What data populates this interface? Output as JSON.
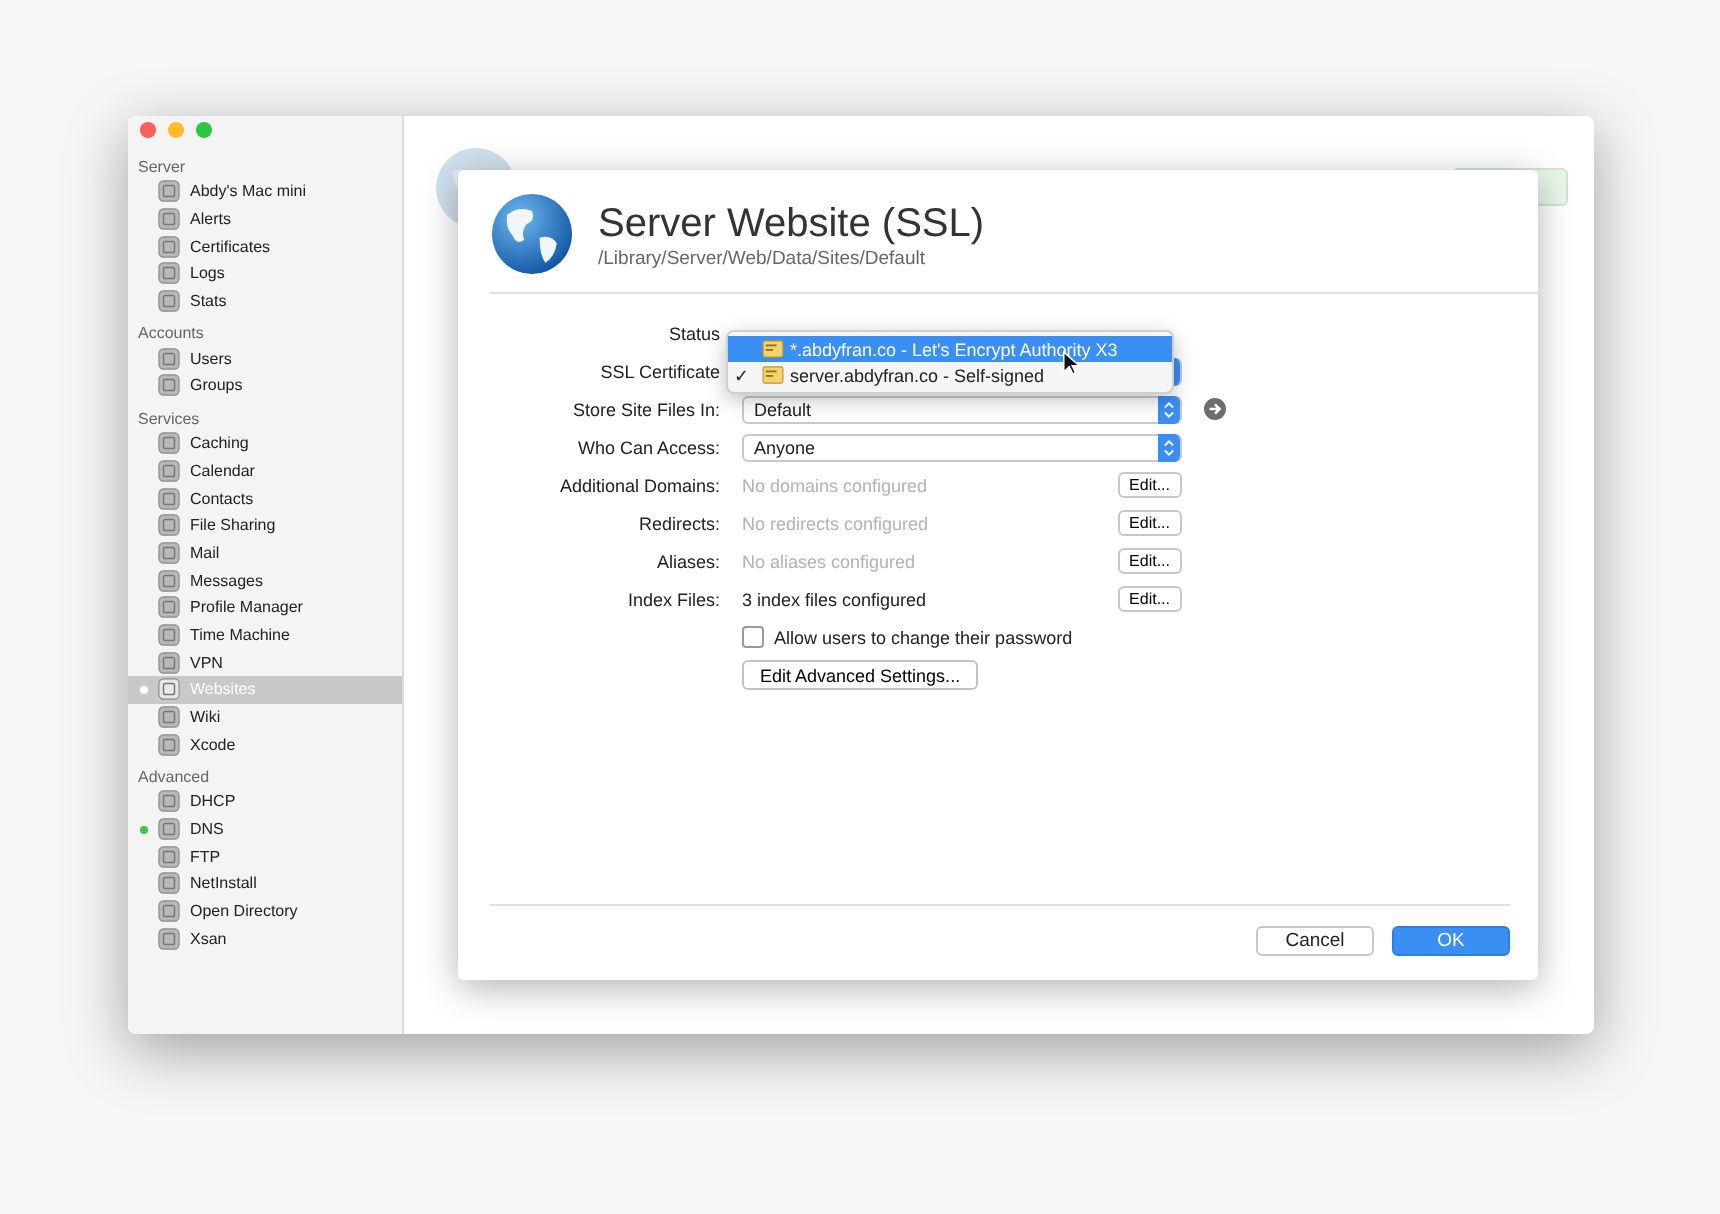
{
  "sidebar": {
    "sections": [
      {
        "title": "Server",
        "items": [
          {
            "label": "Abdy's Mac mini",
            "selected": false,
            "running": false
          },
          {
            "label": "Alerts",
            "selected": false,
            "running": false
          },
          {
            "label": "Certificates",
            "selected": false,
            "running": false
          },
          {
            "label": "Logs",
            "selected": false,
            "running": false
          },
          {
            "label": "Stats",
            "selected": false,
            "running": false
          }
        ]
      },
      {
        "title": "Accounts",
        "items": [
          {
            "label": "Users",
            "selected": false,
            "running": false
          },
          {
            "label": "Groups",
            "selected": false,
            "running": false
          }
        ]
      },
      {
        "title": "Services",
        "items": [
          {
            "label": "Caching",
            "selected": false,
            "running": false
          },
          {
            "label": "Calendar",
            "selected": false,
            "running": false
          },
          {
            "label": "Contacts",
            "selected": false,
            "running": false
          },
          {
            "label": "File Sharing",
            "selected": false,
            "running": false
          },
          {
            "label": "Mail",
            "selected": false,
            "running": false
          },
          {
            "label": "Messages",
            "selected": false,
            "running": false
          },
          {
            "label": "Profile Manager",
            "selected": false,
            "running": false
          },
          {
            "label": "Time Machine",
            "selected": false,
            "running": false
          },
          {
            "label": "VPN",
            "selected": false,
            "running": false
          },
          {
            "label": "Websites",
            "selected": true,
            "running": true
          },
          {
            "label": "Wiki",
            "selected": false,
            "running": false
          },
          {
            "label": "Xcode",
            "selected": false,
            "running": false
          }
        ]
      },
      {
        "title": "Advanced",
        "items": [
          {
            "label": "DHCP",
            "selected": false,
            "running": false
          },
          {
            "label": "DNS",
            "selected": false,
            "running": true
          },
          {
            "label": "FTP",
            "selected": false,
            "running": false
          },
          {
            "label": "NetInstall",
            "selected": false,
            "running": false
          },
          {
            "label": "Open Directory",
            "selected": false,
            "running": false
          },
          {
            "label": "Xsan",
            "selected": false,
            "running": false
          }
        ]
      }
    ]
  },
  "sheet": {
    "title": "Server Website (SSL)",
    "path": "/Library/Server/Web/Data/Sites/Default",
    "rows": [
      {
        "kind": "label",
        "label": "Status"
      },
      {
        "kind": "popup-hidden",
        "label": "SSL Certificate"
      },
      {
        "kind": "popup",
        "label": "Store Site Files In:",
        "value": "Default",
        "arrow": true
      },
      {
        "kind": "popup",
        "label": "Who Can Access:",
        "value": "Anyone",
        "arrow": false
      },
      {
        "kind": "info",
        "label": "Additional Domains:",
        "value": "No domains configured",
        "dimmed": true,
        "button": "Edit..."
      },
      {
        "kind": "info",
        "label": "Redirects:",
        "value": "No redirects configured",
        "dimmed": true,
        "button": "Edit..."
      },
      {
        "kind": "info",
        "label": "Aliases:",
        "value": "No aliases configured",
        "dimmed": true,
        "button": "Edit..."
      },
      {
        "kind": "info",
        "label": "Index Files:",
        "value": "3 index files configured",
        "dimmed": false,
        "button": "Edit..."
      },
      {
        "kind": "checkbox",
        "label": "Allow users to change their password",
        "checked": false
      },
      {
        "kind": "button",
        "label": "Edit Advanced Settings..."
      }
    ],
    "menu": [
      {
        "label": "*.abdyfran.co - Let's Encrypt Authority X3",
        "selected": true,
        "checked": false
      },
      {
        "label": "server.abdyfran.co - Self-signed",
        "selected": false,
        "checked": true
      }
    ],
    "checkmark": "✓",
    "buttons": [
      {
        "label": "Cancel",
        "default": false
      },
      {
        "label": "OK",
        "default": true
      }
    ]
  }
}
